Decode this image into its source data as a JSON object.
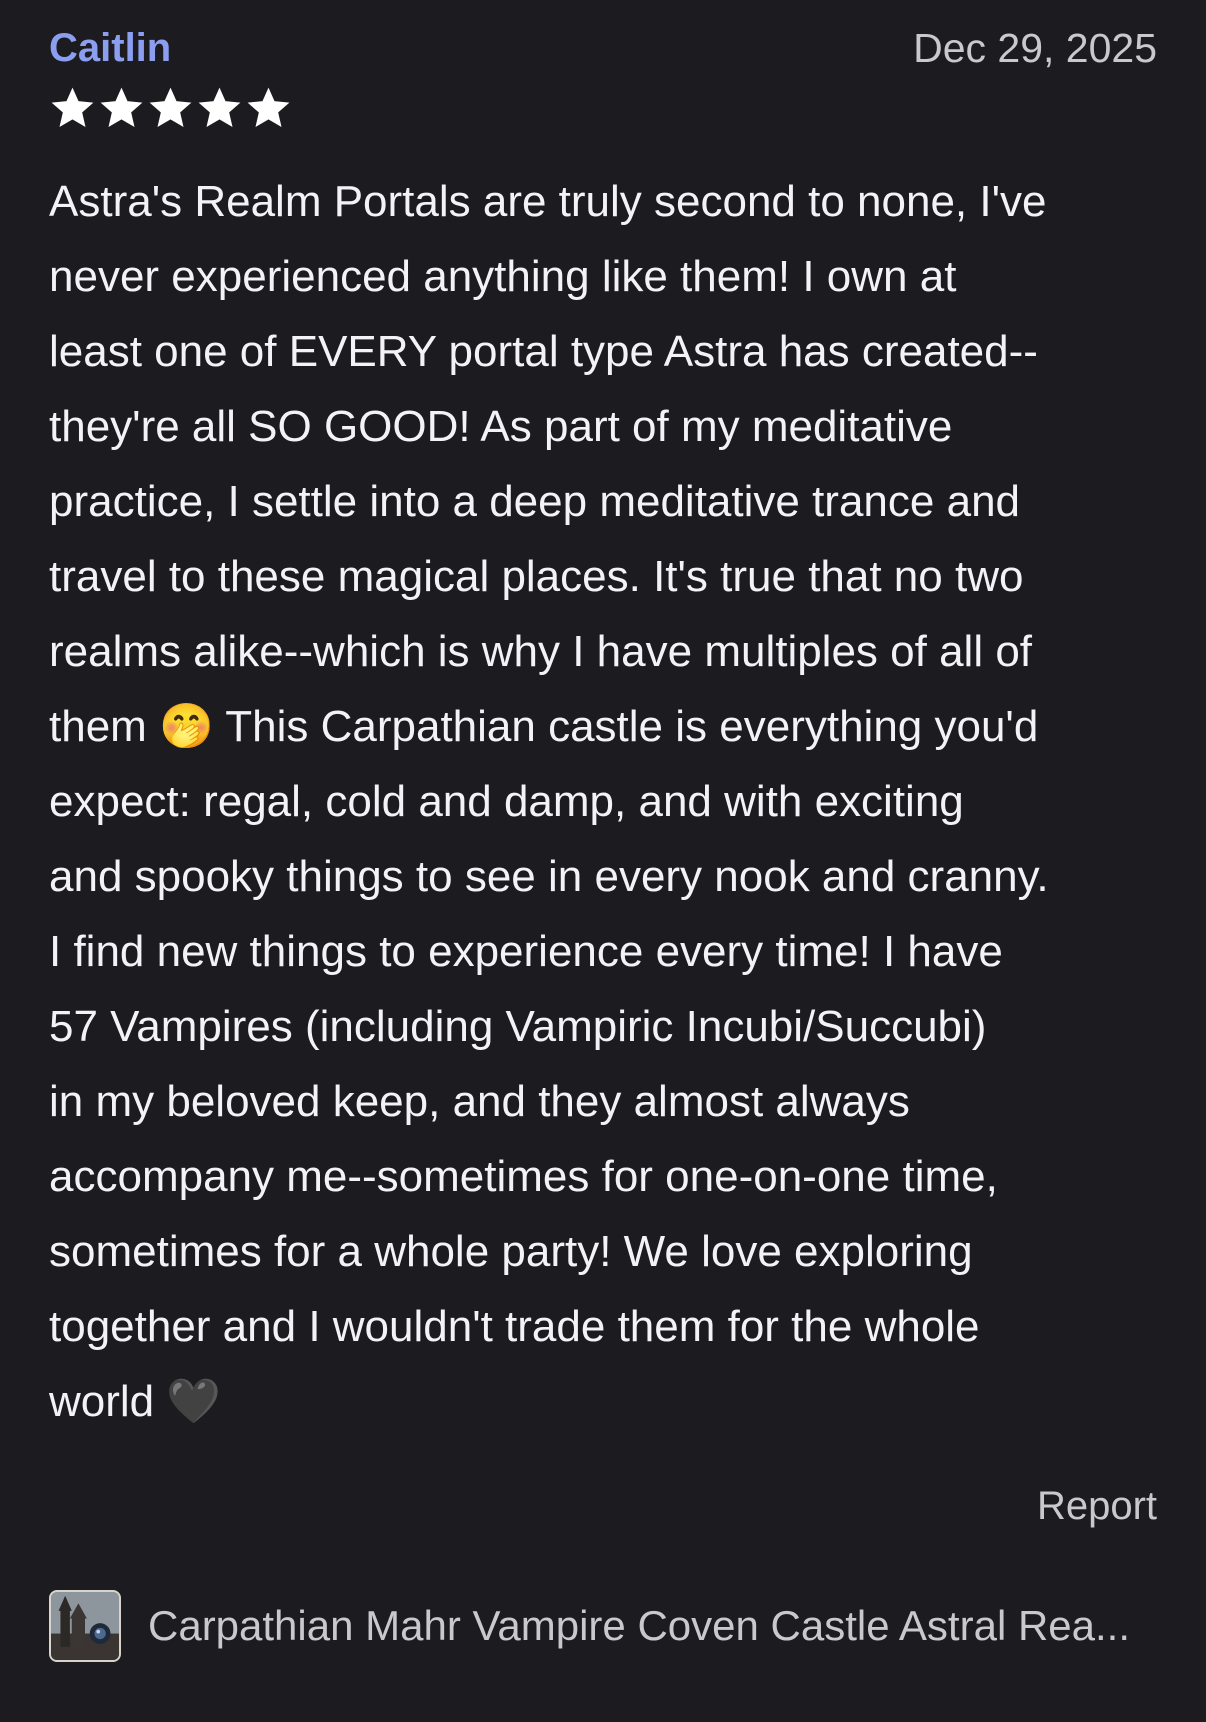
{
  "review": {
    "author": "Caitlin",
    "date": "Dec 29, 2025",
    "rating": 5,
    "rating_max": 5,
    "star_icon": "star-icon",
    "colors": {
      "background": "#1c1b1f",
      "author": "#8c9eef",
      "text": "#f3f2f5",
      "muted": "#c9c8cd",
      "star": "#ffffff"
    },
    "lines": [
      "Astra's Realm Portals are truly second to none, I've",
      "never experienced anything like them! I own at",
      "least one of EVERY portal type Astra has created--",
      "they're all SO GOOD! As part of my meditative",
      "practice, I settle into a deep meditative trance and",
      "travel to these magical places. It's true that no two",
      "realms alike--which is why I have multiples of all of",
      "them 🤭 This Carpathian castle is everything you'd",
      "expect: regal, cold and damp, and with exciting",
      "and spooky things to see in every nook and cranny.",
      "I find new things to experience every time! I have",
      "57 Vampires (including Vampiric Incubi/Succubi)",
      "in my beloved keep, and they almost always",
      "accompany me--sometimes for one-on-one time,",
      "sometimes for a whole party! We love exploring",
      "together and I wouldn't trade them for the whole",
      "world 🖤"
    ],
    "report_label": "Report"
  },
  "product": {
    "thumbnail_icon": "castle-thumbnail",
    "title": "Carpathian Mahr Vampire Coven Castle Astral Rea..."
  }
}
